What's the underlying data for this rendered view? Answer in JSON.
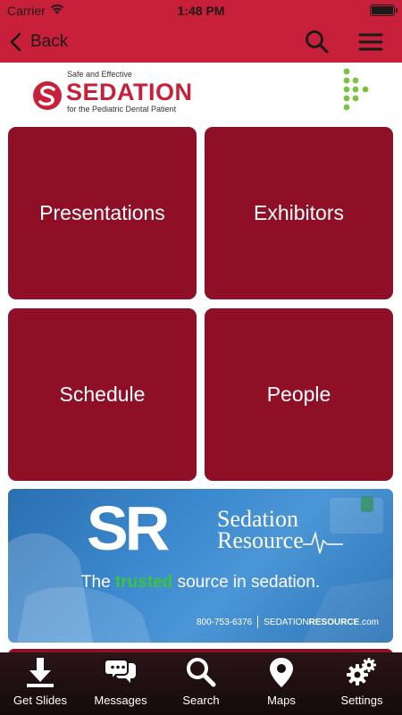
{
  "status_bar": {
    "carrier": "Carrier",
    "time": "1:48 PM",
    "battery_level": 1.0
  },
  "nav": {
    "back_label": "Back",
    "icons": [
      "chevron-left-icon",
      "search-icon",
      "hamburger-menu-icon"
    ]
  },
  "logo": {
    "tag_top": "Safe and Effective",
    "brand": "SEDATION",
    "tag_bottom": "for the Pediatric Dental Patient"
  },
  "tiles": [
    {
      "label": "Presentations"
    },
    {
      "label": "Exhibitors"
    },
    {
      "label": "Schedule"
    },
    {
      "label": "People"
    }
  ],
  "banner": {
    "mark": "SR",
    "name_line1": "Sedation",
    "name_line2": "Resource",
    "tagline_pre": "The ",
    "tagline_highlight": "trusted",
    "tagline_post": " source in sedation.",
    "phone": "800-753-6376",
    "site_prefix": "SEDATION",
    "site_bold": "RESOURCE",
    "site_suffix": ".com"
  },
  "tabbar": {
    "items": [
      {
        "label": "Get Slides",
        "icon": "download-icon"
      },
      {
        "label": "Messages",
        "icon": "chat-bubbles-icon"
      },
      {
        "label": "Search",
        "icon": "search-icon"
      },
      {
        "label": "Maps",
        "icon": "map-pin-icon"
      },
      {
        "label": "Settings",
        "icon": "gears-icon"
      }
    ]
  },
  "colors": {
    "header_red": "#c8203a",
    "tile_maroon": "#8f0f26",
    "tabbar_dark": "#1a0d10",
    "banner_blue": "#3d8ad0",
    "highlight_green": "#3cc43c"
  }
}
